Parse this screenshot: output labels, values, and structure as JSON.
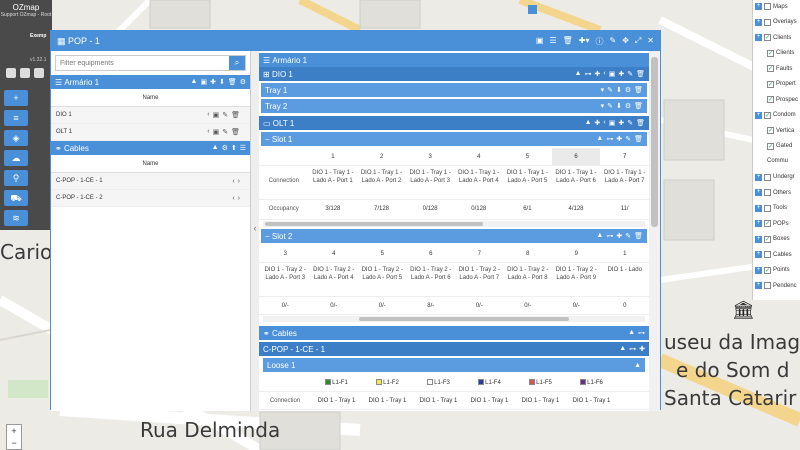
{
  "app": {
    "name": "OZmap",
    "user": "Support OZmap - Root",
    "company": "Exemp",
    "version": "v1.32.1"
  },
  "map": {
    "labels": {
      "street1": "Rua Delminda",
      "place1": "Cario",
      "museum_line1": "useu da Imag",
      "museum_line2": "e do Som d",
      "museum_line3": "Santa Catarir"
    }
  },
  "window": {
    "title": "POP - 1",
    "filter_placeholder": "Filter equipments",
    "left": {
      "armario": {
        "title": "Armário 1",
        "col": "Name",
        "items": [
          "DIO 1",
          "OLT 1"
        ]
      },
      "cables": {
        "title": "Cables",
        "col": "Name",
        "items": [
          "C-POP - 1-CE - 1",
          "C-POP - 1-CE - 2"
        ]
      }
    },
    "right": {
      "armario_title": "Armário 1",
      "dio_title": "DIO 1",
      "trays": [
        "Tray 1",
        "Tray 2"
      ],
      "olt_title": "OLT 1",
      "slot1": {
        "title": "Slot 1",
        "ports": [
          "1",
          "2",
          "3",
          "4",
          "5",
          "6",
          "7"
        ],
        "connection_label": "Connection",
        "connections": [
          "DIO 1 - Tray 1 - Lado A - Port 1",
          "DIO 1 - Tray 1 - Lado A - Port 2",
          "DIO 1 - Tray 1 - Lado A - Port 3",
          "DIO 1 - Tray 1 - Lado A - Port 4",
          "DIO 1 - Tray 1 - Lado A - Port 5",
          "DIO 1 - Tray 1 - Lado A - Port 6",
          "DIO 1 - Tray 1 - Lado A - Port 7"
        ],
        "occupancy_label": "Occupancy",
        "occupancy": [
          "3/128",
          "7/128",
          "0/128",
          "0/128",
          "6/1",
          "4/128",
          "11/"
        ]
      },
      "slot2": {
        "title": "Slot 2",
        "ports": [
          "3",
          "4",
          "5",
          "6",
          "7",
          "8",
          "9",
          "1"
        ],
        "connections": [
          "DIO 1 - Tray 2 - Lado A - Port 3",
          "DIO 1 - Tray 2 - Lado A - Port 4",
          "DIO 1 - Tray 2 - Lado A - Port 5",
          "DIO 1 - Tray 2 - Lado A - Port 6",
          "DIO 1 - Tray 2 - Lado A - Port 7",
          "DIO 1 - Tray 2 - Lado A - Port 8",
          "DIO 1 - Tray 2 - Lado A - Port 9",
          "DIO 1 - Lado"
        ],
        "occupancy": [
          "0/-",
          "0/-",
          "0/-",
          "8/-",
          "0/-",
          "0/-",
          "0/-",
          "0"
        ]
      },
      "cables_title": "Cables",
      "cable1": "C-POP - 1-CE - 1",
      "loose": "Loose 1",
      "fibers": [
        {
          "label": "L1-F1",
          "color": "#2e8b2e"
        },
        {
          "label": "L1-F2",
          "color": "#f2e94e"
        },
        {
          "label": "L1-F3",
          "color": "#ffffff"
        },
        {
          "label": "L1-F4",
          "color": "#2b3aa8"
        },
        {
          "label": "L1-F5",
          "color": "#d9534f"
        },
        {
          "label": "L1-F6",
          "color": "#6b2b8a"
        }
      ],
      "fiber_connection_label": "Connection",
      "fiber_connections": [
        "DIO 1 - Tray 1",
        "DIO 1 - Tray 1",
        "DIO 1 - Tray 1",
        "DIO 1 - Tray 1",
        "DIO 1 - Tray 1",
        "DIO 1 - Tray 1"
      ]
    }
  },
  "layers": [
    {
      "label": "Maps",
      "plus": true
    },
    {
      "label": "Overlays",
      "plus": true
    },
    {
      "label": "Clients",
      "plus": true,
      "checked": true
    },
    {
      "label": "Clients",
      "checked": true,
      "indent": true
    },
    {
      "label": "Faults",
      "checked": true,
      "indent": true
    },
    {
      "label": "Propert",
      "checked": true,
      "indent": true
    },
    {
      "label": "Prospec",
      "checked": true,
      "indent": true
    },
    {
      "label": "Condom",
      "plus": true,
      "checked": true
    },
    {
      "label": "Vertica",
      "checked": true,
      "indent": true
    },
    {
      "label": "Gated",
      "checked": true,
      "indent": true
    },
    {
      "label": "Commu",
      "indent": true,
      "nobox": true
    },
    {
      "label": "Undergr",
      "plus": true
    },
    {
      "label": "Others",
      "plus": true
    },
    {
      "label": "Tools",
      "plus": true
    },
    {
      "label": "POPs",
      "plus": true,
      "checked": true
    },
    {
      "label": "Boxes",
      "plus": true,
      "checked": true
    },
    {
      "label": "Cables",
      "plus": true
    },
    {
      "label": "Points",
      "plus": true,
      "checked": true
    },
    {
      "label": "Pendenc",
      "plus": true
    }
  ]
}
